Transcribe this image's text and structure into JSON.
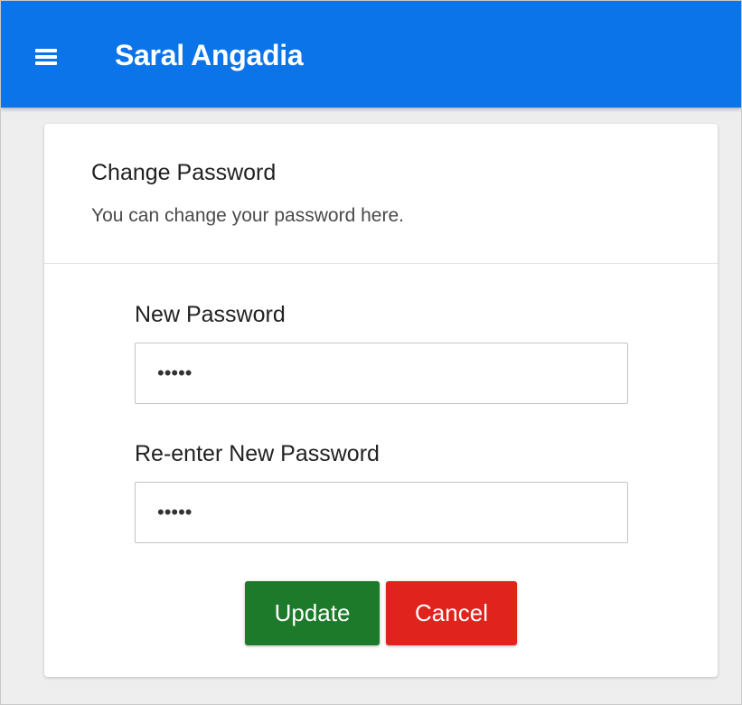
{
  "app": {
    "title": "Saral Angadia"
  },
  "form": {
    "title": "Change Password",
    "subtitle": "You can change your password here.",
    "new_password": {
      "label": "New Password",
      "value": "•••••"
    },
    "confirm_password": {
      "label": "Re-enter New Password",
      "value": "•••••"
    },
    "update_label": "Update",
    "cancel_label": "Cancel"
  },
  "colors": {
    "appbar": "#0a74e8",
    "update_button": "#1d7a2a",
    "cancel_button": "#e0231d",
    "background": "#eeeeee"
  },
  "icons": {
    "menu": "hamburger-menu-icon"
  }
}
